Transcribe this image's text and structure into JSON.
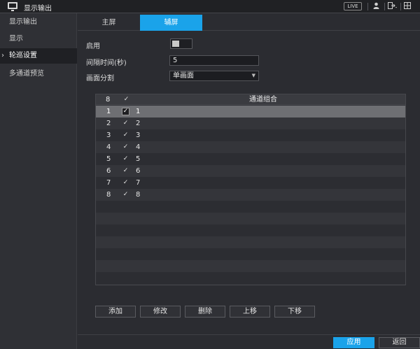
{
  "window": {
    "title": "显示输出",
    "live_badge": "LIVE"
  },
  "titlebar_icons": [
    "user-icon",
    "logout-icon",
    "grid-icon"
  ],
  "sidebar": {
    "items": [
      {
        "label": "显示输出",
        "active": false
      },
      {
        "label": "显示",
        "active": false
      },
      {
        "label": "轮巡设置",
        "active": true
      },
      {
        "label": "多通道预览",
        "active": false
      }
    ]
  },
  "tabs": [
    {
      "label": "主屏",
      "active": false
    },
    {
      "label": "辅屏",
      "active": true
    }
  ],
  "form": {
    "enable_label": "启用",
    "enable_on": false,
    "interval_label": "间隔时间(秒)",
    "interval_value": "5",
    "split_label": "画面分割",
    "split_value": "单画面"
  },
  "table": {
    "header": {
      "count": "8",
      "check": "✓",
      "group": "通道组合"
    },
    "rows": [
      {
        "no": "1",
        "group": "1"
      },
      {
        "no": "2",
        "group": "2"
      },
      {
        "no": "3",
        "group": "3"
      },
      {
        "no": "4",
        "group": "4"
      },
      {
        "no": "5",
        "group": "5"
      },
      {
        "no": "6",
        "group": "6"
      },
      {
        "no": "7",
        "group": "7"
      },
      {
        "no": "8",
        "group": "8"
      }
    ],
    "selected_row": 0
  },
  "actions": {
    "add": "添加",
    "edit": "修改",
    "delete": "删除",
    "up": "上移",
    "down": "下移"
  },
  "footer": {
    "apply": "应用",
    "back": "返回"
  },
  "colors": {
    "accent": "#1aa3ea",
    "selected_row": "#6e6f73"
  }
}
